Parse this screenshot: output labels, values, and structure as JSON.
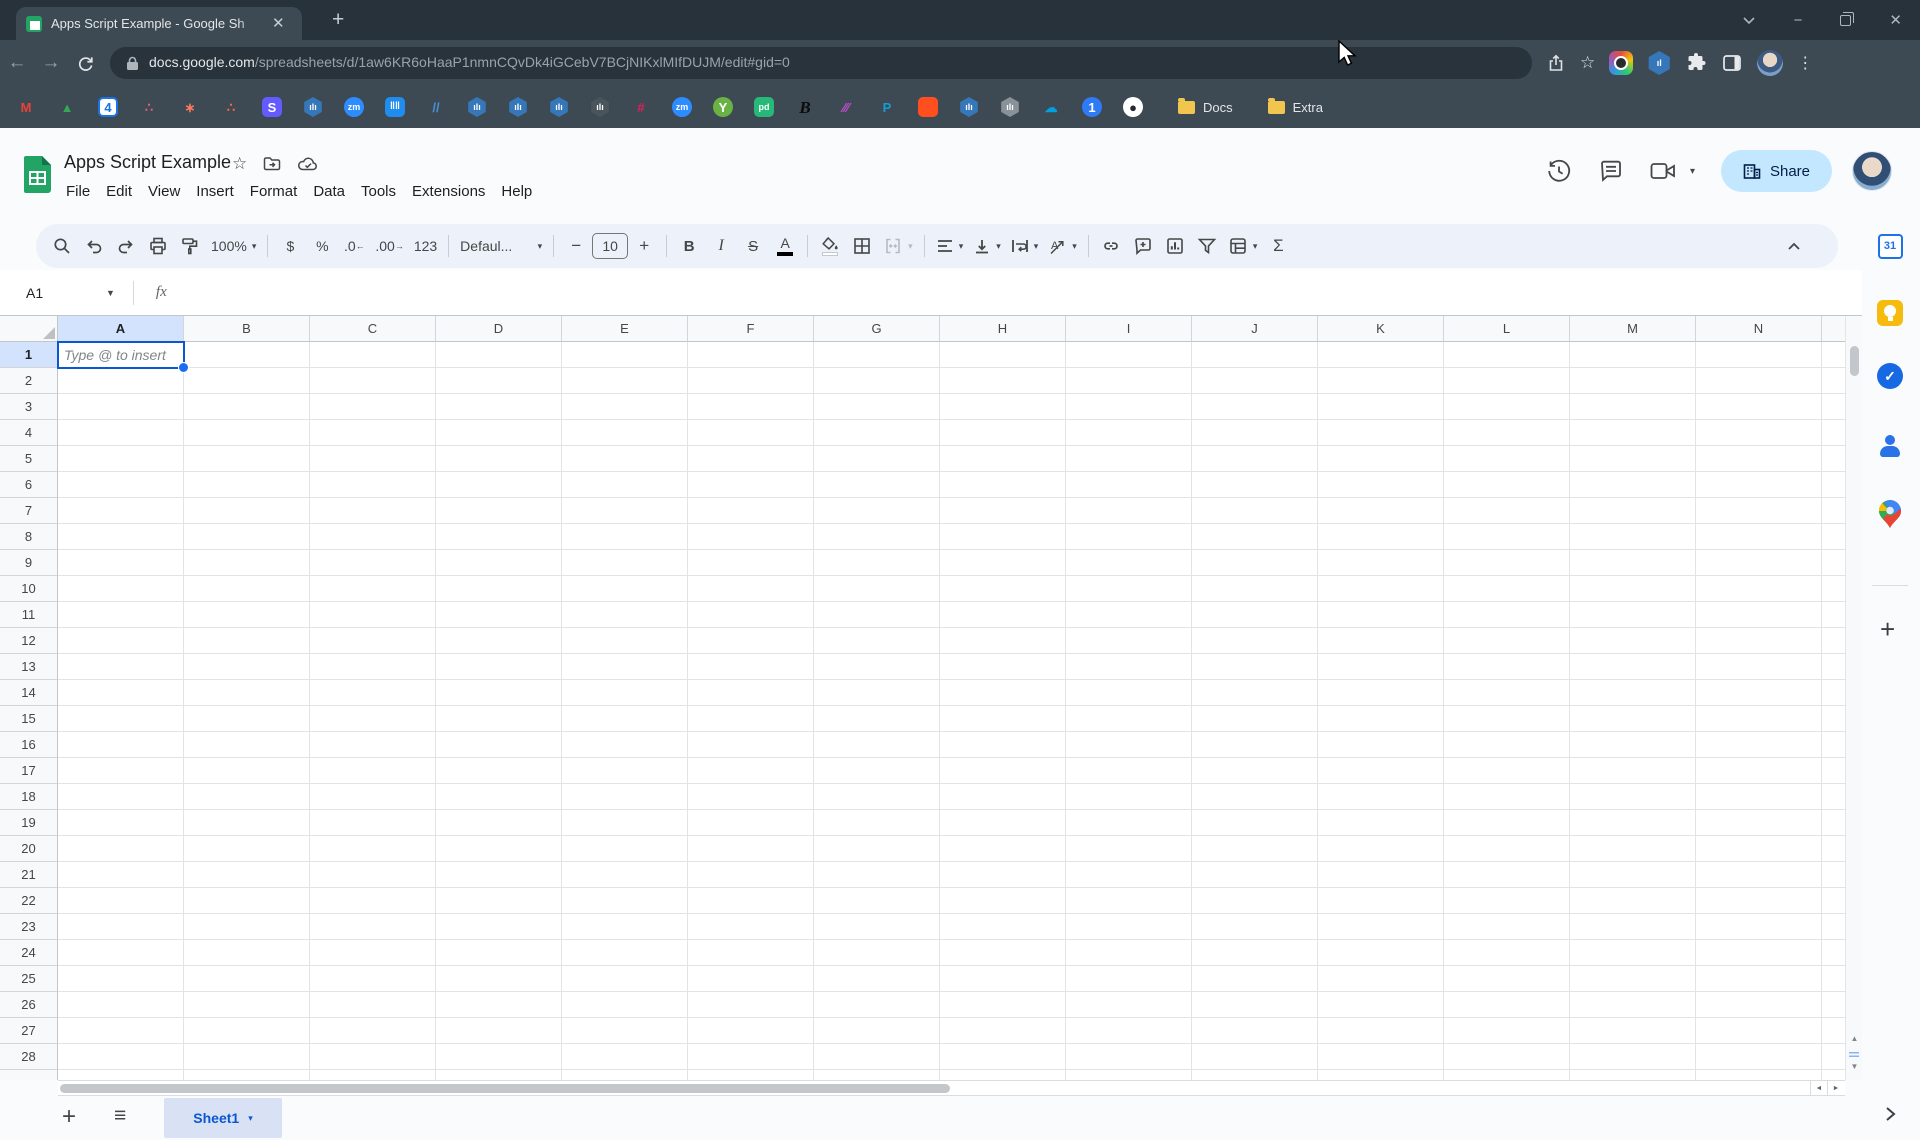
{
  "browser": {
    "tab_title": "Apps Script Example - Google Sh",
    "new_tab_glyph": "+",
    "close_glyph": "✕",
    "window_controls": {
      "minimize": "−",
      "close": "✕"
    },
    "url_host": "docs.google.com",
    "url_path": "/spreadsheets/d/1aw6KR6oHaaP1nmnCQvDk4iGCebV7BCjNIKxlMIfDUJM/edit#gid=0",
    "back_glyph": "←",
    "forward_glyph": "→",
    "star_glyph": "☆",
    "kebab_glyph": "⋮",
    "bookmarks": [
      {
        "name": "gmail-bookmark",
        "glyph": "M",
        "fg": "#ea4335",
        "bg": "",
        "shape": ""
      },
      {
        "name": "drive-bookmark",
        "glyph": "▲",
        "fg": "#34a853",
        "bg": "",
        "shape": ""
      },
      {
        "name": "calendar-bookmark",
        "glyph": "4",
        "fg": "#1a73e8",
        "bg": "#ffffff",
        "shape": "shape-square",
        "border": "2px solid #1a73e8"
      },
      {
        "name": "asana-bookmark",
        "glyph": "∴",
        "fg": "#ea5f7a",
        "bg": "",
        "shape": ""
      },
      {
        "name": "hubspot-bookmark",
        "glyph": "∗",
        "fg": "#ff7a59",
        "bg": "",
        "shape": ""
      },
      {
        "name": "orange-dots-bookmark",
        "glyph": "∴",
        "fg": "#ff6d3f",
        "bg": "",
        "shape": ""
      },
      {
        "name": "stripe-bookmark",
        "glyph": "S",
        "fg": "#ffffff",
        "bg": "#635bff",
        "shape": "shape-square"
      },
      {
        "name": "analytics-hex-bookmark-1",
        "glyph": "ılı",
        "fg": "#ffffff",
        "bg": "#3577b8",
        "shape": "hex"
      },
      {
        "name": "zoom-bookmark",
        "glyph": "zm",
        "fg": "#ffffff",
        "bg": "#2d8cff",
        "shape": "shape-circle"
      },
      {
        "name": "intercom-bookmark",
        "glyph": "‖‖",
        "fg": "#ffffff",
        "bg": "#1f8ded",
        "shape": "shape-square"
      },
      {
        "name": "slashes-bookmark",
        "glyph": "//",
        "fg": "#4a90d9",
        "bg": "",
        "shape": ""
      },
      {
        "name": "analytics-hex-bookmark-2",
        "glyph": "ılı",
        "fg": "#ffffff",
        "bg": "#3577b8",
        "shape": "hex"
      },
      {
        "name": "analytics-hex-bookmark-3",
        "glyph": "ılı",
        "fg": "#ffffff",
        "bg": "#3577b8",
        "shape": "hex"
      },
      {
        "name": "analytics-hex-bookmark-4",
        "glyph": "ılı",
        "fg": "#ffffff",
        "bg": "#3577b8",
        "shape": "hex"
      },
      {
        "name": "analytics-hex-dark-bookmark",
        "glyph": "ılı",
        "fg": "#ffffff",
        "bg": "#4a545b",
        "shape": "hex"
      },
      {
        "name": "slack-bookmark",
        "glyph": "#",
        "fg": "#e01e5a",
        "bg": "",
        "shape": ""
      },
      {
        "name": "zoom-bookmark-2",
        "glyph": "zm",
        "fg": "#ffffff",
        "bg": "#2d8cff",
        "shape": "shape-circle"
      },
      {
        "name": "branch-green-bookmark",
        "glyph": "Y",
        "fg": "#ffffff",
        "bg": "#69b345",
        "shape": "shape-circle"
      },
      {
        "name": "pandadoc-bookmark",
        "glyph": "pd",
        "fg": "#ffffff",
        "bg": "#27b979",
        "shape": "shape-square"
      },
      {
        "name": "script-b-bookmark",
        "glyph": "B",
        "fg": "#0c0c0c",
        "bg": "",
        "shape": "serif-it"
      },
      {
        "name": "stripes-magenta-bookmark",
        "glyph": "⁄⁄⁄",
        "fg": "#c24bd4",
        "bg": "",
        "shape": ""
      },
      {
        "name": "paypal-bookmark",
        "glyph": "P",
        "fg": "#179bd7",
        "bg": "",
        "shape": ""
      },
      {
        "name": "orange-square-bookmark",
        "glyph": "",
        "fg": "#ffffff",
        "bg": "#ff4f1f",
        "shape": "shape-square"
      },
      {
        "name": "analytics-hex-bookmark-5",
        "glyph": "ılı",
        "fg": "#ffffff",
        "bg": "#3577b8",
        "shape": "hex"
      },
      {
        "name": "analytics-hex-gray-bookmark",
        "glyph": "ılı",
        "fg": "#ffffff",
        "bg": "#8a9299",
        "shape": "hex"
      },
      {
        "name": "salesforce-bookmark",
        "glyph": "☁",
        "fg": "#00a1e0",
        "bg": "",
        "shape": ""
      },
      {
        "name": "onepassword-bookmark",
        "glyph": "1",
        "fg": "#ffffff",
        "bg": "#2f7bf5",
        "shape": "shape-circle"
      },
      {
        "name": "github-bookmark",
        "glyph": "●",
        "fg": "#24292f",
        "bg": "#ffffff",
        "shape": "shape-circle"
      }
    ],
    "bookmark_folders": [
      {
        "name": "docs-folder",
        "label": "Docs"
      },
      {
        "name": "extra-folder",
        "label": "Extra"
      }
    ]
  },
  "sheets": {
    "title": "Apps Script Example",
    "star_glyph": "☆",
    "menus": [
      "File",
      "Edit",
      "View",
      "Insert",
      "Format",
      "Data",
      "Tools",
      "Extensions",
      "Help"
    ],
    "share_label": "Share",
    "toolbar": {
      "zoom": "100%",
      "currency": "$",
      "percent": "%",
      "decrease_decimal": ".0",
      "increase_decimal": ".00",
      "more_formats": "123",
      "font_family": "Defaul...",
      "minus": "−",
      "font_size": "10",
      "plus": "+",
      "bold": "B",
      "italic": "I",
      "strikethrough": "S",
      "text_color": "A",
      "sum": "Σ"
    },
    "formula_bar": {
      "name_box": "A1",
      "fx": "fx"
    },
    "grid": {
      "columns": [
        "A",
        "B",
        "C",
        "D",
        "E",
        "F",
        "G",
        "H",
        "I",
        "J",
        "K",
        "L",
        "M",
        "N"
      ],
      "rows": [
        "1",
        "2",
        "3",
        "4",
        "5",
        "6",
        "7",
        "8",
        "9",
        "10",
        "11",
        "12",
        "13",
        "14",
        "15",
        "16",
        "17",
        "18",
        "19",
        "20",
        "21",
        "22",
        "23",
        "24",
        "25",
        "26",
        "27",
        "28"
      ],
      "active_cell": "A1",
      "placeholder": "Type @ to insert",
      "selected_column": "A",
      "selected_row": "1"
    },
    "bottom_bar": {
      "add_glyph": "+",
      "all_sheets_glyph": "≡",
      "sheet_tab": "Sheet1"
    },
    "rail": {
      "calendar_label": "31",
      "tasks_check": "✓",
      "plus_glyph": "+"
    }
  },
  "colors": {
    "chrome_dark": "#27323a",
    "chrome_mid": "#3d4a53",
    "url_pill": "#28333b",
    "sheets_green": "#21a464",
    "accent_blue": "#0b57d0",
    "selection_blue": "#d3e3fd",
    "share_bg": "#c2e7ff",
    "toolbar_bg": "#edf2fa",
    "app_bg": "#f9fbfd"
  }
}
